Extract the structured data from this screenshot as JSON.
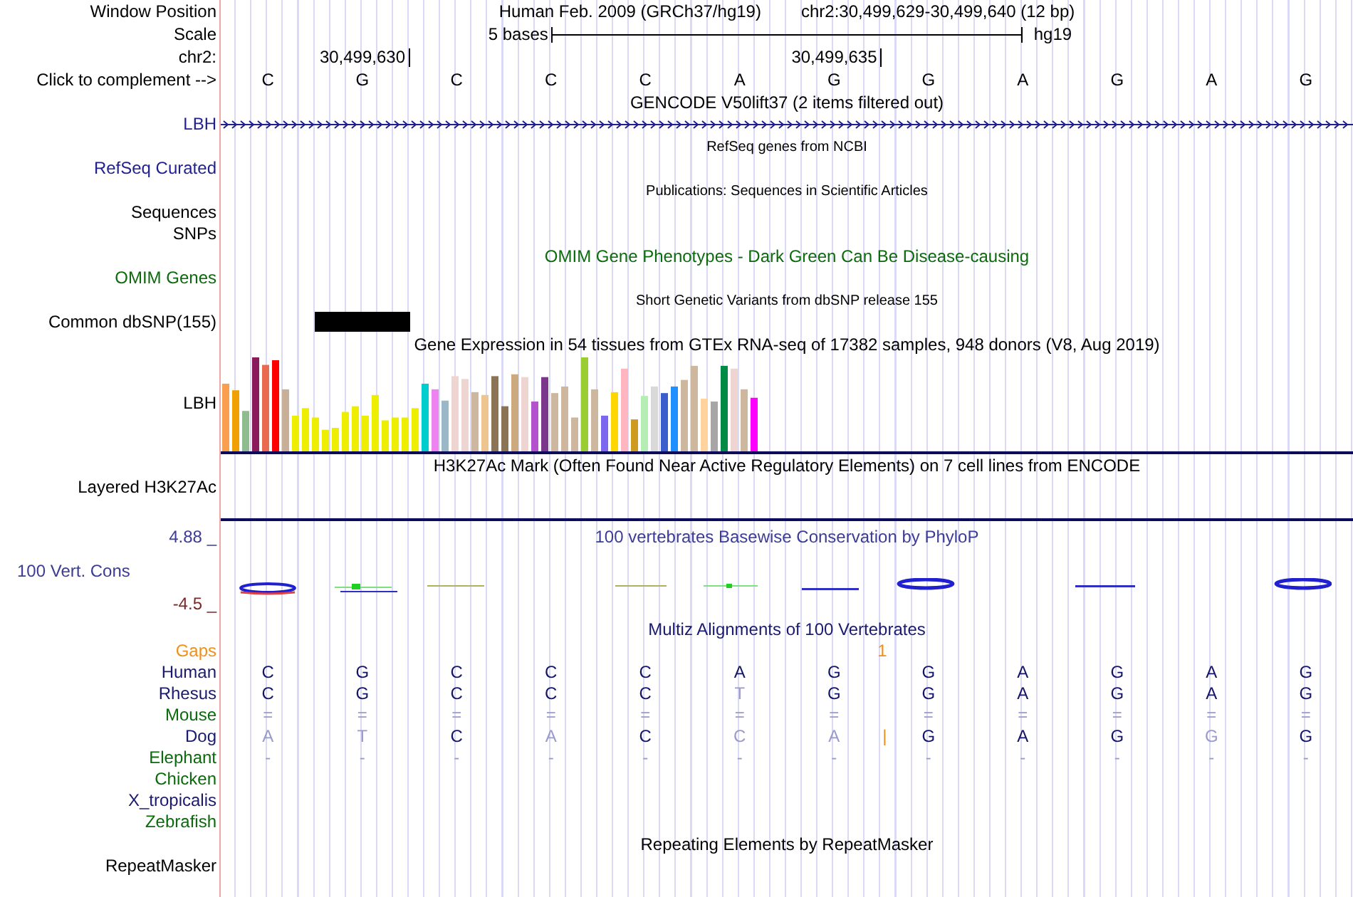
{
  "position": {
    "label": "Window Position",
    "assembly": "Human Feb. 2009 (GRCh37/hg19)",
    "range": "chr2:30,499,629-30,499,640 (12 bp)"
  },
  "scale": {
    "label": "Scale",
    "left": "5 bases",
    "right": "hg19"
  },
  "ruler": {
    "label": "chr2:",
    "cells": [
      {
        "tick": false
      },
      {
        "tick": true,
        "text": "30,499,630"
      },
      {
        "tick": false
      },
      {
        "tick": false
      },
      {
        "tick": false
      },
      {
        "tick": false
      },
      {
        "tick": true,
        "text": "30,499,635"
      },
      {
        "tick": false
      },
      {
        "tick": false
      },
      {
        "tick": false
      },
      {
        "tick": false
      },
      {
        "tick": false
      }
    ]
  },
  "sequence": {
    "label": "Click to complement -->",
    "bases": [
      "C",
      "G",
      "C",
      "C",
      "C",
      "A",
      "G",
      "G",
      "A",
      "G",
      "A",
      "G"
    ]
  },
  "tracks": [
    {
      "kind": "gene",
      "title": {
        "text": "GENCODE V50lift37 (2 items filtered out)",
        "small": false,
        "color": "#000000"
      },
      "labels": [
        {
          "text": "LBH",
          "color": "#1f1f8f"
        }
      ]
    },
    {
      "kind": "empty",
      "title": {
        "text": "RefSeq genes from NCBI",
        "small": true,
        "color": "#000000"
      },
      "labels": [
        {
          "text": "RefSeq Curated",
          "color": "#1f1f8f"
        }
      ]
    },
    {
      "kind": "empty",
      "title": {
        "text": "Publications: Sequences in Scientific Articles",
        "small": true,
        "color": "#000000"
      },
      "labels": [
        {
          "text": "Sequences",
          "color": "#000000"
        },
        {
          "text": "SNPs",
          "color": "#000000"
        }
      ]
    },
    {
      "kind": "empty",
      "title": {
        "text": "OMIM Gene Phenotypes - Dark Green Can Be Disease-causing",
        "small": false,
        "color": "#0b6a0b"
      },
      "labels": [
        {
          "text": "OMIM Genes",
          "color": "#0b6a0b"
        }
      ]
    },
    {
      "kind": "variants",
      "title": {
        "text": "Short Genetic Variants from dbSNP release 155",
        "small": true,
        "color": "#000000"
      },
      "labels": [
        {
          "text": "Common dbSNP(155)",
          "color": "#000000"
        }
      ],
      "marked": [
        false,
        true,
        false,
        false,
        false,
        false,
        false,
        false,
        false,
        false,
        false,
        false
      ]
    },
    {
      "kind": "bars",
      "title": {
        "text": "Gene Expression in 54 tissues from GTEx RNA-seq of 17382 samples, 948 donors (V8, Aug 2019)",
        "small": false,
        "color": "#000000"
      },
      "labels": [
        {
          "text": "LBH",
          "color": "#000000"
        }
      ]
    },
    {
      "kind": "layered",
      "title": {
        "text": "H3K27Ac Mark (Often Found Near Active Regulatory Elements) on 7 cell lines from ENCODE",
        "small": false,
        "color": "#000000"
      },
      "labels": [
        {
          "text": "Layered H3K27Ac",
          "color": "#000000"
        }
      ]
    },
    {
      "kind": "conservation",
      "title": {
        "text": "100 vertebrates Basewise Conservation by PhyloP",
        "small": false,
        "color": "#3c3c96"
      },
      "labels": [
        {
          "text": "100 Vert. Cons",
          "color": "#3c3c96"
        }
      ],
      "ymax": "4.88 _",
      "ymin": "-4.5 _"
    },
    {
      "kind": "multiz",
      "title": {
        "text": "Multiz Alignments of 100 Vertebrates",
        "small": false,
        "color": "#1a1a6e"
      },
      "rows": [
        {
          "kind": "gaps",
          "label": "Gaps",
          "color": "#f0901a",
          "cells": [
            {},
            {},
            {},
            {},
            {},
            {},
            {
              "insert": "1"
            },
            {},
            {},
            {},
            {},
            {}
          ]
        },
        {
          "kind": "species",
          "label": "Human",
          "color": "#1a1a6e",
          "cells": [
            {
              "base": "C",
              "faint": false
            },
            {
              "base": "G",
              "faint": false
            },
            {
              "base": "C",
              "faint": false
            },
            {
              "base": "C",
              "faint": false
            },
            {
              "base": "C",
              "faint": false
            },
            {
              "base": "A",
              "faint": false
            },
            {
              "base": "G",
              "faint": false
            },
            {
              "base": "G",
              "faint": false
            },
            {
              "base": "A",
              "faint": false
            },
            {
              "base": "G",
              "faint": false
            },
            {
              "base": "A",
              "faint": false
            },
            {
              "base": "G",
              "faint": false
            }
          ]
        },
        {
          "kind": "species",
          "label": "Rhesus",
          "color": "#1a1a6e",
          "cells": [
            {
              "base": "C",
              "faint": false
            },
            {
              "base": "G",
              "faint": false
            },
            {
              "base": "C",
              "faint": false
            },
            {
              "base": "C",
              "faint": false
            },
            {
              "base": "C",
              "faint": false
            },
            {
              "base": "T",
              "faint": true
            },
            {
              "base": "G",
              "faint": false
            },
            {
              "base": "G",
              "faint": false
            },
            {
              "base": "A",
              "faint": false
            },
            {
              "base": "G",
              "faint": false
            },
            {
              "base": "A",
              "faint": false
            },
            {
              "base": "G",
              "faint": false
            }
          ]
        },
        {
          "kind": "species",
          "label": "Mouse",
          "color": "#0b6a0b",
          "cells": [
            {
              "base": "=",
              "faint": true
            },
            {
              "base": "=",
              "faint": true
            },
            {
              "base": "=",
              "faint": true
            },
            {
              "base": "=",
              "faint": true
            },
            {
              "base": "=",
              "faint": true
            },
            {
              "base": "=",
              "faint": true
            },
            {
              "base": "=",
              "faint": true
            },
            {
              "base": "=",
              "faint": true
            },
            {
              "base": "=",
              "faint": true
            },
            {
              "base": "=",
              "faint": true
            },
            {
              "base": "=",
              "faint": true
            },
            {
              "base": "=",
              "faint": true
            }
          ]
        },
        {
          "kind": "species",
          "label": "Dog",
          "color": "#1a1a6e",
          "cells": [
            {
              "base": "A",
              "faint": true
            },
            {
              "base": "T",
              "faint": true
            },
            {
              "base": "C",
              "faint": false
            },
            {
              "base": "A",
              "faint": true
            },
            {
              "base": "C",
              "faint": false
            },
            {
              "base": "C",
              "faint": true
            },
            {
              "base": "A",
              "faint": true,
              "insert": "|"
            },
            {
              "base": "G",
              "faint": false
            },
            {
              "base": "A",
              "faint": false
            },
            {
              "base": "G",
              "faint": false
            },
            {
              "base": "G",
              "faint": true
            },
            {
              "base": "G",
              "faint": false
            }
          ]
        },
        {
          "kind": "species",
          "label": "Elephant",
          "color": "#0b6a0b",
          "cells": [
            {
              "base": "-",
              "faint": true
            },
            {
              "base": "-",
              "faint": true
            },
            {
              "base": "-",
              "faint": true
            },
            {
              "base": "-",
              "faint": true
            },
            {
              "base": "-",
              "faint": true
            },
            {
              "base": "-",
              "faint": true
            },
            {
              "base": "-",
              "faint": true
            },
            {
              "base": "-",
              "faint": true
            },
            {
              "base": "-",
              "faint": true
            },
            {
              "base": "-",
              "faint": true
            },
            {
              "base": "-",
              "faint": true
            },
            {
              "base": "-",
              "faint": true
            }
          ]
        },
        {
          "kind": "species",
          "label": "Chicken",
          "color": "#0b6a0b"
        },
        {
          "kind": "species",
          "label": "X_tropicalis",
          "color": "#1a1a6e"
        },
        {
          "kind": "species",
          "label": "Zebrafish",
          "color": "#0b6a0b"
        }
      ]
    },
    {
      "kind": "empty",
      "title": {
        "text": "Repeating Elements by RepeatMasker",
        "small": false,
        "color": "#000000"
      },
      "labels": [
        {
          "text": "RepeatMasker",
          "color": "#000000"
        }
      ]
    }
  ]
}
